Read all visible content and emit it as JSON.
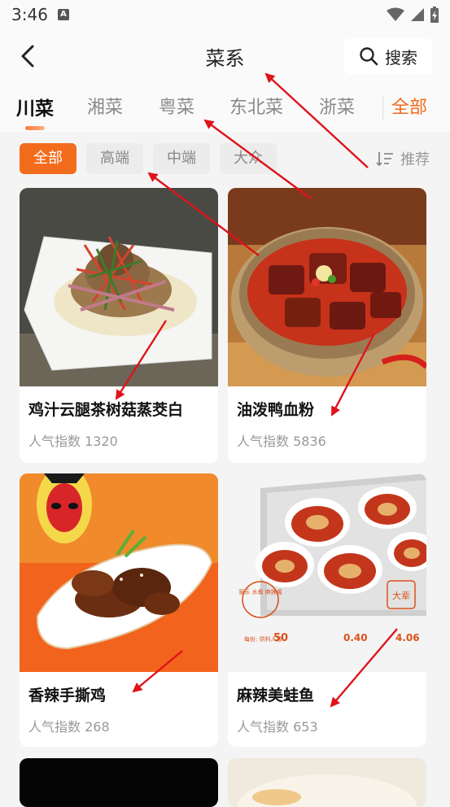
{
  "status": {
    "time": "3:46"
  },
  "nav": {
    "title": "菜系",
    "search_label": "搜索"
  },
  "categories": [
    "川菜",
    "湘菜",
    "粤菜",
    "东北菜",
    "浙菜"
  ],
  "category_all": "全部",
  "filters": [
    "全部",
    "高端",
    "中端",
    "大众"
  ],
  "sort_label": "推荐",
  "dishes": [
    {
      "name": "鸡汁云腿茶树菇蒸茭白",
      "popularity": "人气指数 1320"
    },
    {
      "name": "油泼鸭血粉",
      "popularity": "人气指数 5836"
    },
    {
      "name": "香辣手撕鸡",
      "popularity": "人气指数 268"
    },
    {
      "name": "麻辣美蛙鱼",
      "popularity": "人气指数 653"
    }
  ],
  "promo": {
    "badge": "大辈",
    "circle_label": "家乐 水煮 麻辣酱",
    "price_prefix": "每份: 供料人数",
    "serving": "50",
    "cost_1": "0.40",
    "cost_2": "4.06"
  },
  "colors": {
    "accent": "#f26a1b",
    "annotation": "#e0121b"
  }
}
